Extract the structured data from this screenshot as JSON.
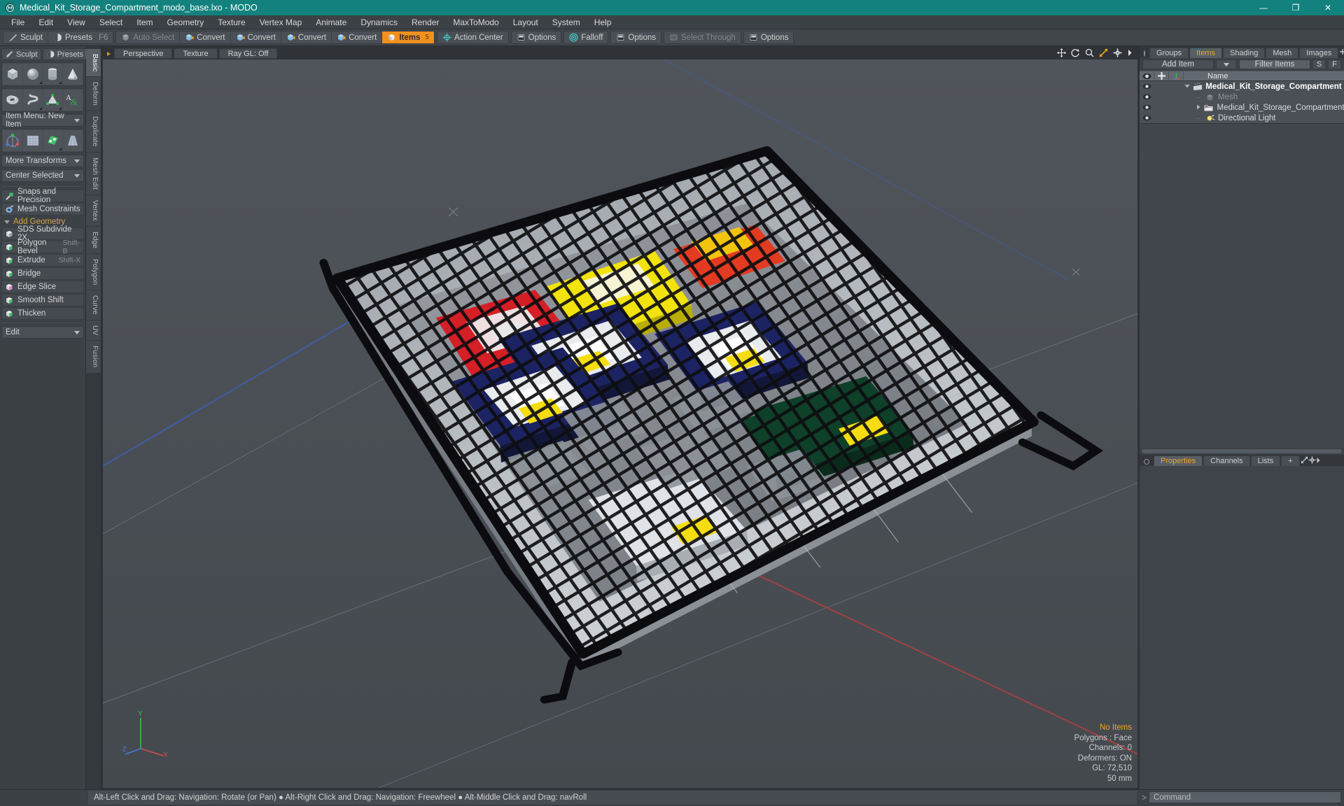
{
  "window": {
    "title": "Medical_Kit_Storage_Compartment_modo_base.lxo - MODO",
    "logo_icon": "modo-logo-icon",
    "minimize_label": "—",
    "maximize_label": "❐",
    "close_label": "✕"
  },
  "menubar": {
    "items": [
      "File",
      "Edit",
      "View",
      "Select",
      "Item",
      "Geometry",
      "Texture",
      "Vertex Map",
      "Animate",
      "Dynamics",
      "Render",
      "MaxToModo",
      "Layout",
      "System",
      "Help"
    ]
  },
  "toolbar": {
    "groups": [
      {
        "buttons": [
          {
            "label": "Sculpt",
            "icon": "sculpt-icon",
            "state": "normal"
          },
          {
            "label": "Presets",
            "icon": "presets-icon",
            "state": "normal",
            "hotkey": "F6"
          }
        ]
      },
      {
        "buttons": [
          {
            "label": "Auto Select",
            "icon": "cube-grey-icon",
            "state": "disabled"
          },
          {
            "label": "Convert",
            "icon": "convert-vertex-icon",
            "state": "normal"
          },
          {
            "label": "Convert",
            "icon": "convert-edge-icon",
            "state": "normal"
          },
          {
            "label": "Convert",
            "icon": "convert-polygon-icon",
            "state": "normal"
          },
          {
            "label": "Convert",
            "icon": "convert-material-icon",
            "state": "normal"
          },
          {
            "label": "Items",
            "icon": "items-cube-icon",
            "state": "active",
            "hotkey": "5"
          }
        ]
      },
      {
        "buttons": [
          {
            "label": "Action Center",
            "icon": "action-center-icon",
            "state": "normal"
          }
        ]
      },
      {
        "buttons": [
          {
            "label": "Options",
            "icon": "options-icon",
            "state": "normal"
          }
        ]
      },
      {
        "buttons": [
          {
            "label": "Falloff",
            "icon": "falloff-icon",
            "state": "normal"
          }
        ]
      },
      {
        "buttons": [
          {
            "label": "Options",
            "icon": "options-icon",
            "state": "normal"
          }
        ]
      },
      {
        "buttons": [
          {
            "label": "Select Through",
            "icon": "select-through-icon",
            "state": "disabled"
          }
        ]
      },
      {
        "buttons": [
          {
            "label": "Options",
            "icon": "options-icon",
            "state": "normal"
          }
        ]
      }
    ]
  },
  "left_panel": {
    "header_buttons": [
      {
        "label": "Sculpt",
        "icon": "sculpt-brush-icon"
      },
      {
        "label": "Presets",
        "icon": "presets-sphere-icon",
        "hotkey": "F6"
      }
    ],
    "primitives_row1": [
      {
        "icon": "cube-primitive-icon",
        "name": "cube"
      },
      {
        "icon": "sphere-primitive-icon",
        "name": "sphere"
      },
      {
        "icon": "cylinder-primitive-icon",
        "name": "cylinder"
      },
      {
        "icon": "cone-primitive-icon",
        "name": "cone"
      }
    ],
    "primitives_row2": [
      {
        "icon": "torus-primitive-icon",
        "name": "torus"
      },
      {
        "icon": "helix-primitive-icon",
        "name": "helix"
      },
      {
        "icon": "tetrahedron-primitive-icon",
        "name": "tetrahedron"
      },
      {
        "icon": "text-primitive-icon",
        "name": "text"
      }
    ],
    "item_menu": "Item Menu: New Item",
    "transform_row": [
      {
        "icon": "transform-gizmo-icon",
        "name": "transform"
      },
      {
        "icon": "bend-grid-icon",
        "name": "bend"
      },
      {
        "icon": "shear-grid-icon",
        "name": "shear"
      },
      {
        "icon": "taper-grid-icon",
        "name": "taper"
      }
    ],
    "more_transforms": "More Transforms",
    "center_selected": "Center Selected",
    "snaps_label": "Snaps and Precision",
    "snaps_icon": "magnet-snap-icon",
    "mesh_constraints_label": "Mesh Constraints",
    "mesh_constraints_icon": "mesh-constraint-icon",
    "add_geometry_label": "Add Geometry",
    "geometry_tools": [
      {
        "label": "SDS Subdivide 2X",
        "icon": "sds-subdivide-icon",
        "hotkey": ""
      },
      {
        "label": "Polygon Bevel",
        "icon": "polygon-bevel-icon",
        "hotkey": "Shift-B"
      },
      {
        "label": "Extrude",
        "icon": "extrude-icon",
        "hotkey": "Shift-X"
      },
      {
        "label": "Bridge",
        "icon": "bridge-icon",
        "hotkey": ""
      },
      {
        "label": "Edge Slice",
        "icon": "edge-slice-icon",
        "hotkey": ""
      },
      {
        "label": "Smooth Shift",
        "icon": "smooth-shift-icon",
        "hotkey": ""
      },
      {
        "label": "Thicken",
        "icon": "thicken-icon",
        "hotkey": ""
      }
    ],
    "edit_dropdown": "Edit",
    "vertical_tabs": [
      {
        "label": "Basic",
        "selected": true
      },
      {
        "label": "Deform",
        "selected": false
      },
      {
        "label": "Duplicate",
        "selected": false
      },
      {
        "label": "Mesh Edit",
        "selected": false
      },
      {
        "label": "Vertex",
        "selected": false
      },
      {
        "label": "Edge",
        "selected": false
      },
      {
        "label": "Polygon",
        "selected": false
      },
      {
        "label": "Curve",
        "selected": false
      },
      {
        "label": "UV",
        "selected": false
      },
      {
        "label": "Fusion",
        "selected": false
      }
    ]
  },
  "viewport": {
    "tabs": [
      "Perspective",
      "Texture",
      "Ray GL: Off"
    ],
    "corner_icons": [
      "move-icon",
      "rotate-icon",
      "zoom-icon",
      "fit-icon",
      "gear-icon",
      "chevron-right-icon"
    ],
    "stats": {
      "items": "No Items",
      "polygons": "Polygons : Face",
      "channels": "Channels: 0",
      "deformers": "Deformers: ON",
      "gl": "GL: 72,510",
      "scale": "50 mm"
    },
    "axis_labels": {
      "x": "X",
      "y": "Y",
      "z": "Z"
    },
    "background_color": "#4a4f54",
    "floor_color": "#b8bcc0"
  },
  "right_panel": {
    "tabs": [
      {
        "label": "Groups",
        "selected": false
      },
      {
        "label": "Items",
        "selected": true
      },
      {
        "label": "Shading",
        "selected": false
      },
      {
        "label": "Mesh ...",
        "selected": false
      },
      {
        "label": "Images",
        "selected": false
      }
    ],
    "tab_extras": [
      "plus-icon",
      "expand-icon",
      "gear-icon",
      "chevron-right-icon"
    ],
    "add_item_label": "Add Item",
    "filter_placeholder": "Filter Items",
    "s_button": "S",
    "f_button": "F",
    "tree_headers": {
      "eye": "visibility-icon",
      "lock": "lock-icon",
      "axis": "axis-icon",
      "name": "Name"
    },
    "tree_rows": [
      {
        "label": "Medical_Kit_Storage_Compartment ...",
        "icon": "scene-clapper-icon",
        "indent": 0,
        "bold": true,
        "dim": false,
        "expander": "down"
      },
      {
        "label": "Mesh",
        "icon": "mesh-cube-icon",
        "indent": 1,
        "bold": false,
        "dim": true,
        "expander": "none"
      },
      {
        "label": "Medical_Kit_Storage_Compartment",
        "icon": "mesh-folder-icon",
        "indent": 1,
        "bold": false,
        "dim": false,
        "expander": "right"
      },
      {
        "label": "Directional Light",
        "icon": "light-icon",
        "indent": 1,
        "bold": false,
        "dim": false,
        "expander": "none"
      }
    ],
    "prop_tabs": [
      {
        "label": "Properties",
        "selected": true
      },
      {
        "label": "Channels",
        "selected": false
      },
      {
        "label": "Lists",
        "selected": false
      },
      {
        "label": "+",
        "selected": false
      }
    ]
  },
  "statusbar": {
    "message": "Alt-Left Click and Drag: Navigation: Rotate (or Pan) ● Alt-Right Click and Drag: Navigation: Freewheel ● Alt-Middle Click and Drag: navRoll",
    "command_prompt": ">",
    "command_placeholder": "Command"
  }
}
